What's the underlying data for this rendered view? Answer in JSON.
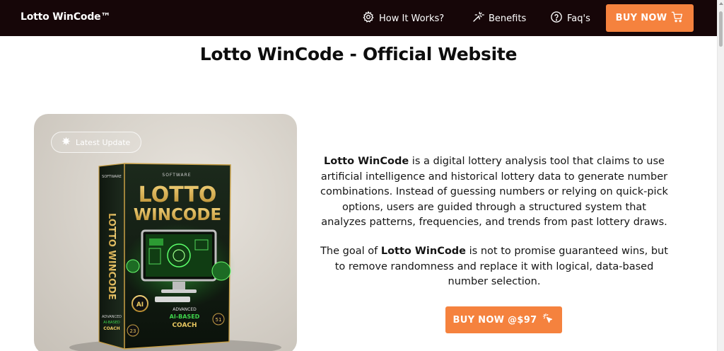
{
  "navbar": {
    "brand": "Lotto WinCode™",
    "items": [
      {
        "label": "How It Works?",
        "icon": "gear-icon"
      },
      {
        "label": "Benefits",
        "icon": "magic-wand-icon"
      },
      {
        "label": "Faq's",
        "icon": "question-circle-icon"
      }
    ],
    "buy_label": "BUY NOW",
    "buy_icon": "cart-icon"
  },
  "page": {
    "title": "Lotto WinCode - Official Website"
  },
  "product_image": {
    "badge_label": "Latest Update",
    "badge_icon": "sparkle-icon",
    "box_top_label": "SOFTWARE",
    "box_title_line1": "LOTTO",
    "box_title_line2": "WINCODE",
    "box_spine_label": "LOTTO WINCODE",
    "box_spine_top": "SOFTWARE",
    "box_bottom_line1": "ADVANCED",
    "box_bottom_line2": "AI-BASED",
    "box_bottom_line3": "COACH",
    "box_ai_badge": "AI",
    "box_number_left": "23",
    "box_number_right": "51",
    "spine_bottom_line1": "ADVANCED",
    "spine_bottom_line2": "AI-BASED",
    "spine_bottom_line3": "COACH"
  },
  "description": {
    "p1_bold": "Lotto WinCode",
    "p1_text": " is a digital lottery analysis tool that claims to use artificial intelligence and historical lottery data to generate number combinations. Instead of guessing numbers or relying on quick-pick options, users are guided through a structured system that analyzes patterns, frequencies, and trends from past lottery draws.",
    "p2_prefix": "The goal of ",
    "p2_bold": "Lotto WinCode",
    "p2_text": " is not to promise guaranteed wins, but to remove randomness and replace it with logical, data-based number selection."
  },
  "cta": {
    "label": "BUY NOW @$97",
    "icon": "cursor-click-icon"
  },
  "colors": {
    "navbar_bg": "#160608",
    "accent": "#f5823e",
    "box_green": "#2fbf3a",
    "box_gold": "#d8b04a"
  }
}
